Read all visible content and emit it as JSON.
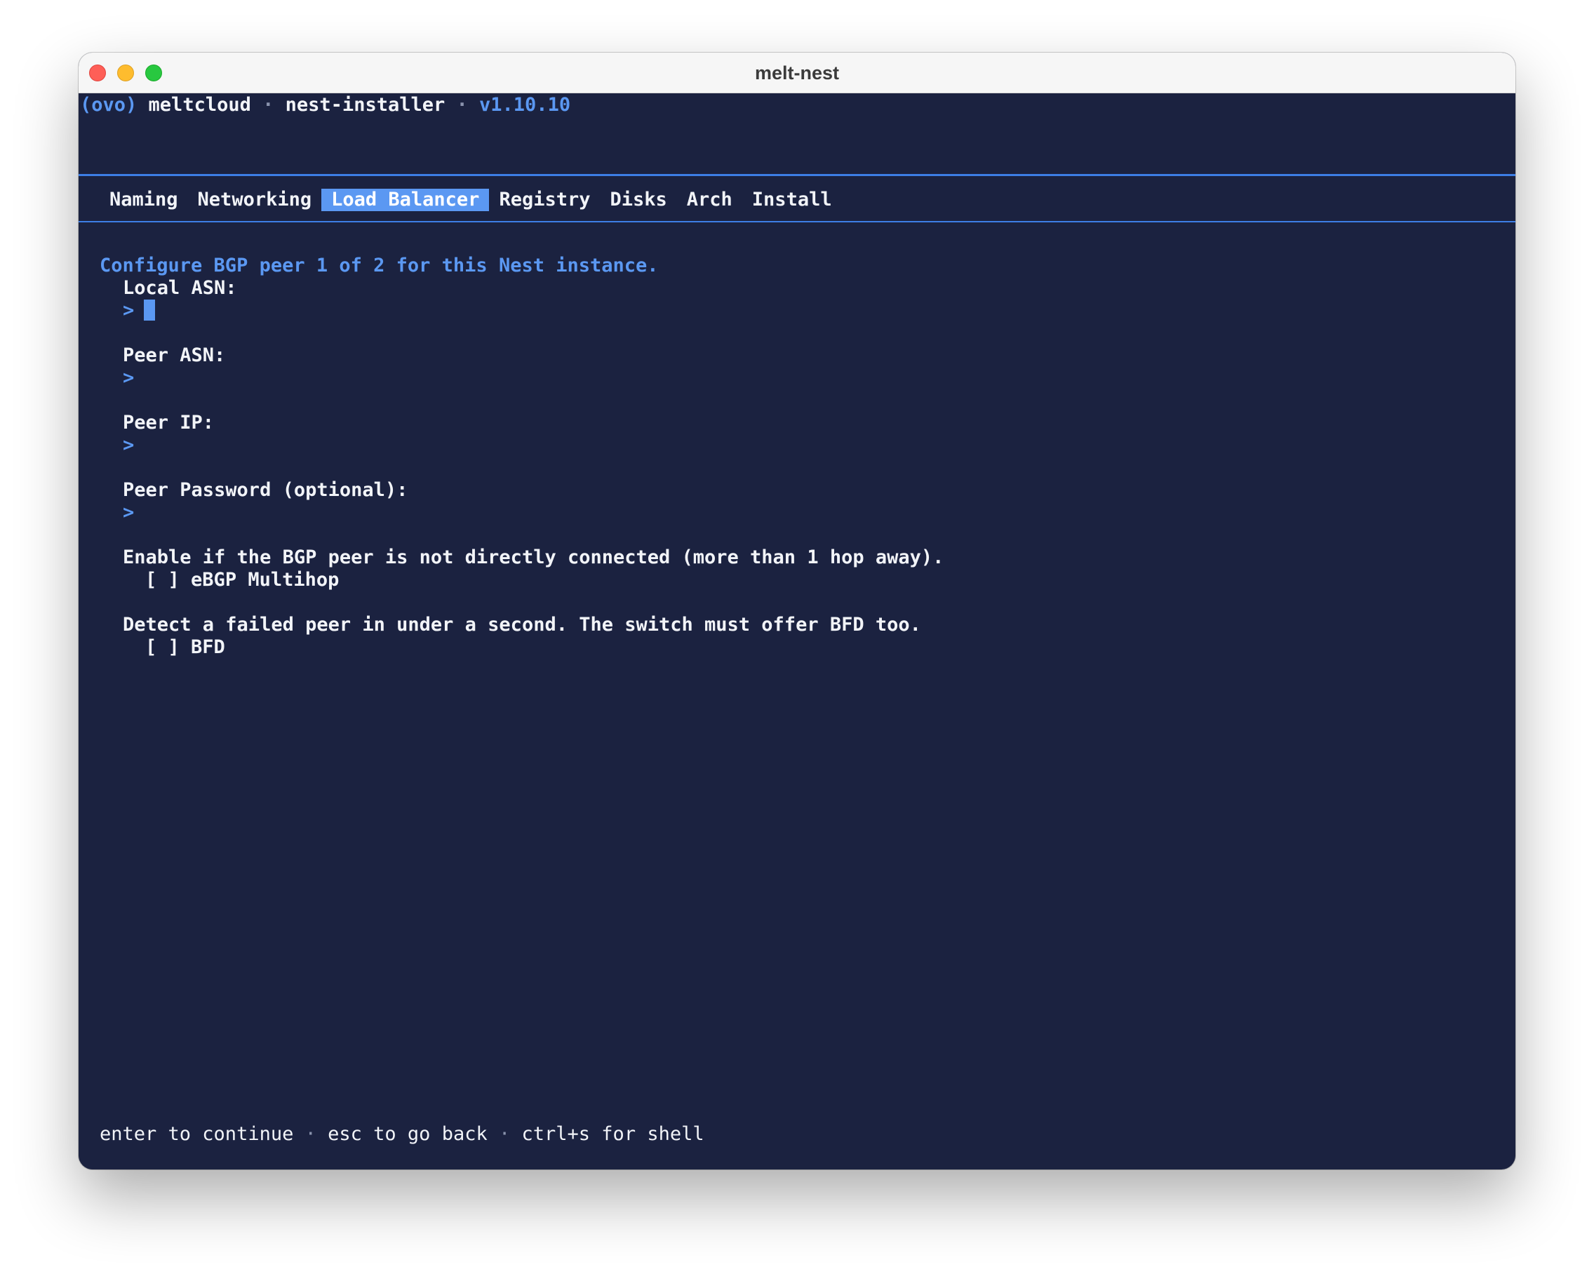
{
  "window": {
    "title": "melt-nest"
  },
  "header": {
    "logo": "(ovo)",
    "product": "meltcloud",
    "separator": "·",
    "app": "nest-installer",
    "version": "v1.10.10"
  },
  "tabs": [
    {
      "label": "Naming",
      "active": false
    },
    {
      "label": "Networking",
      "active": false
    },
    {
      "label": "Load Balancer",
      "active": true
    },
    {
      "label": "Registry",
      "active": false
    },
    {
      "label": "Disks",
      "active": false
    },
    {
      "label": "Arch",
      "active": false
    },
    {
      "label": "Install",
      "active": false
    }
  ],
  "form": {
    "heading": "Configure BGP peer 1 of 2 for this Nest instance.",
    "prompt_symbol": ">",
    "fields": [
      {
        "label": "Local ASN:",
        "value": ""
      },
      {
        "label": "Peer ASN:",
        "value": ""
      },
      {
        "label": "Peer IP:",
        "value": ""
      },
      {
        "label": "Peer Password (optional):",
        "value": ""
      }
    ],
    "options": [
      {
        "description": "Enable if the BGP peer is not directly connected (more than 1 hop away).",
        "checkbox": "[ ]",
        "label": "eBGP Multihop",
        "checked": false
      },
      {
        "description": "Detect a failed peer in under a second. The switch must offer BFD too.",
        "checkbox": "[ ]",
        "label": "BFD",
        "checked": false
      }
    ]
  },
  "footer": {
    "hints": [
      "enter to continue",
      "esc to go back",
      "ctrl+s for shell"
    ],
    "separator": "·"
  },
  "colors": {
    "background": "#1b2240",
    "accent": "#5b98f2",
    "text": "#f2f4f8",
    "muted": "#8a93ad"
  }
}
